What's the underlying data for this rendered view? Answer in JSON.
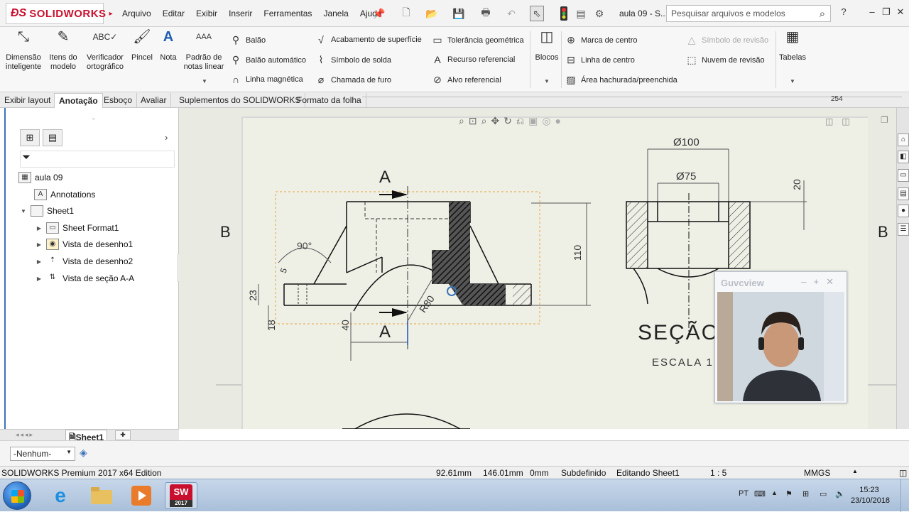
{
  "app": {
    "logo_text": "SOLIDWORKS",
    "doc_title": "aula 09 - S...",
    "menus": [
      "Arquivo",
      "Editar",
      "Exibir",
      "Inserir",
      "Ferramentas",
      "Janela",
      "Ajuda"
    ],
    "search_placeholder": "Pesquisar arquivos e modelos"
  },
  "ribbon": {
    "big_tools": [
      {
        "label": "Dimensão inteligente",
        "icon": "smart-dimension-icon"
      },
      {
        "label": "Itens do modelo",
        "icon": "model-items-icon"
      },
      {
        "label": "Verificador ortográfico",
        "icon": "spell-checker-icon"
      },
      {
        "label": "Pincel",
        "icon": "format-painter-icon"
      },
      {
        "label": "Nota",
        "icon": "note-icon"
      },
      {
        "label": "Padrão de notas linear",
        "icon": "linear-note-pattern-icon"
      }
    ],
    "col1": [
      "Balão",
      "Balão automático",
      "Linha magnética"
    ],
    "col2": [
      "Acabamento de superfície",
      "Símbolo de solda",
      "Chamada de furo"
    ],
    "col3": [
      "Tolerância geométrica",
      "Recurso referencial",
      "Alvo referencial"
    ],
    "blocks_label": "Blocos",
    "col4": [
      "Marca de centro",
      "Linha de centro",
      "Área hachurada/preenchida"
    ],
    "col5": [
      "Símbolo de revisão",
      "Nuvem de revisão"
    ],
    "tables_label": "Tabelas"
  },
  "tabs": [
    "Exibir layout",
    "Anotação",
    "Esboço",
    "Avaliar",
    "Suplementos do SOLIDWORKS",
    "Formato da folha"
  ],
  "active_tab": "Anotação",
  "ruler_value": "254",
  "tree": {
    "root": "aula 09",
    "annotations": "Annotations",
    "sheet": "Sheet1",
    "children": [
      "Sheet Format1",
      "Vista de desenho1",
      "Vista de desenho2",
      "Vista de seção A-A"
    ]
  },
  "sheet_tab": "Sheet1",
  "drawing": {
    "zone_left": "B",
    "zone_right": "B",
    "section_top": "A",
    "section_bottom": "A",
    "angle": "90°",
    "dims": {
      "d100": "Ø100",
      "d75": "Ø75",
      "h20": "20",
      "h110": "110",
      "h23": "23",
      "h18": "18",
      "h40": "40",
      "r80": "R80",
      "h5": "5"
    },
    "section_title": "SEÇÃO",
    "scale_label": "ESCALA 1:"
  },
  "layer": "-Nenhum-",
  "status": {
    "edition": "SOLIDWORKS Premium 2017 x64 Edition",
    "x": "92.61mm",
    "y": "146.01mm",
    "z": "0mm",
    "state": "Subdefinido",
    "editing": "Editando Sheet1",
    "scale": "1 : 5",
    "units": "MMGS"
  },
  "webcam": {
    "title": "Guvcview"
  },
  "taskbar": {
    "lang": "PT",
    "time": "15:23",
    "date": "23/10/2018",
    "sw_badge": "2017"
  },
  "colors": {
    "brand": "#c8102e",
    "selection": "#e8a23a",
    "tree_border": "#3b73b9"
  }
}
